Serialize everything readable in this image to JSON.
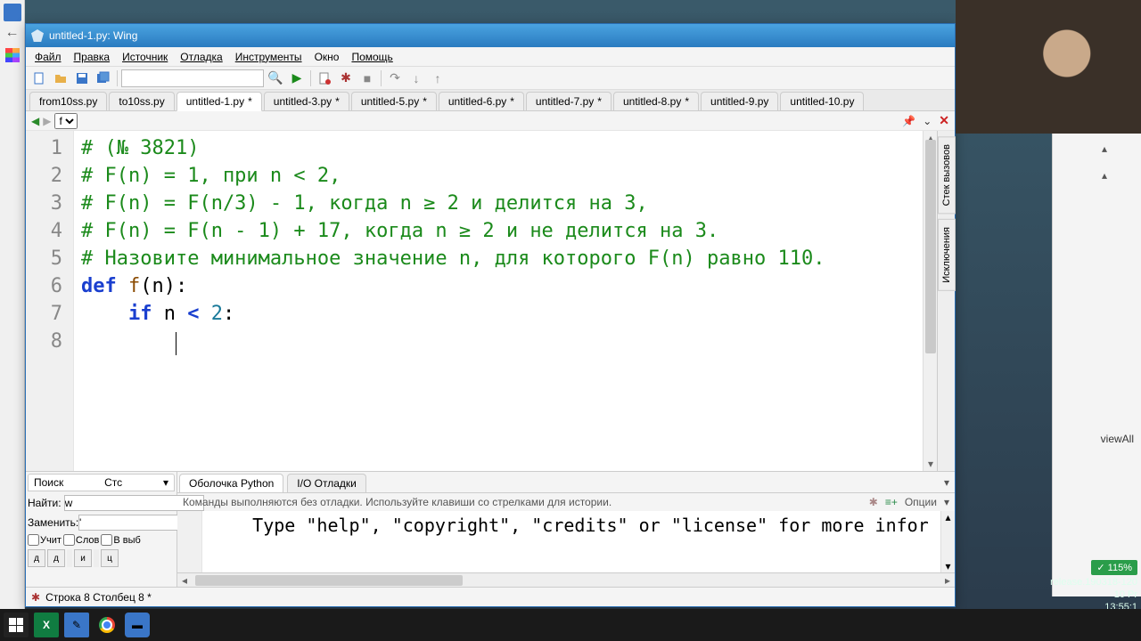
{
  "window": {
    "title": "untitled-1.py: Wing"
  },
  "menu": {
    "file": "Файл",
    "edit": "Правка",
    "source": "Источник",
    "debug": "Отладка",
    "tools": "Инструменты",
    "window": "Окно",
    "help": "Помощь"
  },
  "tabs": [
    {
      "label": "from10ss.py",
      "mod": false
    },
    {
      "label": "to10ss.py",
      "mod": false
    },
    {
      "label": "untitled-1.py",
      "mod": true
    },
    {
      "label": "untitled-3.py",
      "mod": true
    },
    {
      "label": "untitled-5.py",
      "mod": true
    },
    {
      "label": "untitled-6.py",
      "mod": true
    },
    {
      "label": "untitled-7.py",
      "mod": true
    },
    {
      "label": "untitled-8.py",
      "mod": true
    },
    {
      "label": "untitled-9.py",
      "mod": false
    },
    {
      "label": "untitled-10.py",
      "mod": false
    }
  ],
  "nav": {
    "symbol": "f"
  },
  "code": {
    "lines": [
      {
        "n": "1",
        "comment": "# (№ 3821)"
      },
      {
        "n": "2",
        "comment": "# F(n) = 1, при n < 2,"
      },
      {
        "n": "3",
        "comment": "# F(n) = F(n/3) - 1, когда n ≥ 2 и делится на 3,"
      },
      {
        "n": "4",
        "comment": "# F(n) = F(n - 1) + 17, когда n ≥ 2 и не делится на 3."
      },
      {
        "n": "5",
        "comment": "# Назовите минимальное значение n, для которого F(n) равно 110."
      }
    ],
    "kw_def": "def",
    "fn": "f",
    "paren_open": "(n):",
    "kw_if": "if",
    "cond": " n ",
    "lt": "<",
    "num2": " 2",
    "colon": ":",
    "l6": "6",
    "l7": "7",
    "l8": "8"
  },
  "search": {
    "panel": "Поиск",
    "stack": "Стс",
    "find_label": "Найти:",
    "find_value": "w",
    "replace_label": "Заменить:",
    "replace_value": "'",
    "case": "Учит",
    "word": "Слов",
    "sel": "В выб",
    "b1": "д",
    "b2": "д",
    "b3": "и",
    "b4": "ц"
  },
  "shell": {
    "tab1": "Оболочка Python",
    "tab2": "I/O Отладки",
    "hint": "Команды выполняются без отладки.  Используйте клавиши со стрелками для истории.",
    "options": "Опции",
    "line": "    Type \"help\", \"copyright\", \"credits\" or \"license\" for more infor"
  },
  "status": {
    "text": "Строка 8 Столбец 8 *"
  },
  "side": {
    "v1": "Стек вызовов",
    "v2": "Исключения"
  },
  "right": {
    "viewall": "viewAll",
    "green": "✓  115%",
    "rel": "release.190318-120"
  },
  "taskbar": {
    "clock": "13:55:1",
    "date": "10 Pr"
  }
}
